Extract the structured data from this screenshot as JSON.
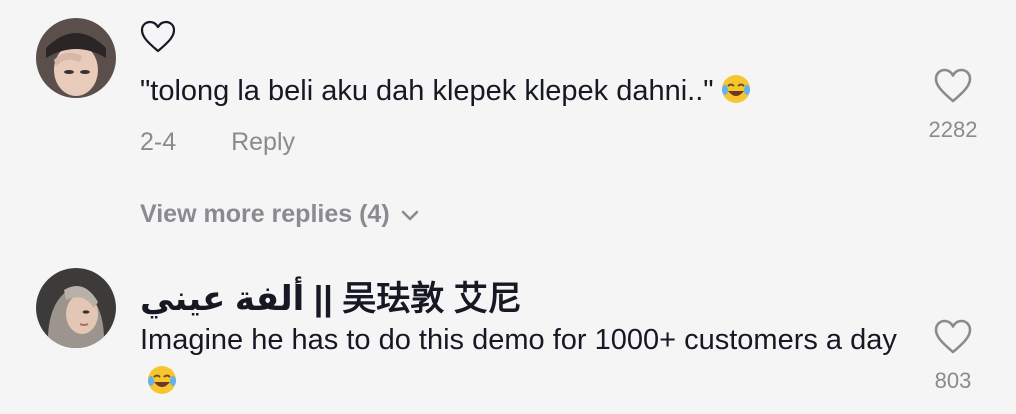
{
  "comments": [
    {
      "username": "",
      "text": "\"tolong la beli aku dah klepek klepek dahni..\"",
      "emoji": "tears-of-joy-emoji",
      "date": "2-4",
      "reply_label": "Reply",
      "like_count": "2282"
    },
    {
      "username": "ألفة عيني || 吴珐敦 艾尼",
      "text": "Imagine he has to do this demo for 1000+ customers a day",
      "emoji": "tears-of-joy-emoji",
      "like_count": "803"
    }
  ],
  "view_more": {
    "label": "View more replies (4)",
    "icon": "chevron-down-icon"
  },
  "colors": {
    "background": "#f5f5f5",
    "text": "#161823",
    "muted": "#8a8b91"
  }
}
